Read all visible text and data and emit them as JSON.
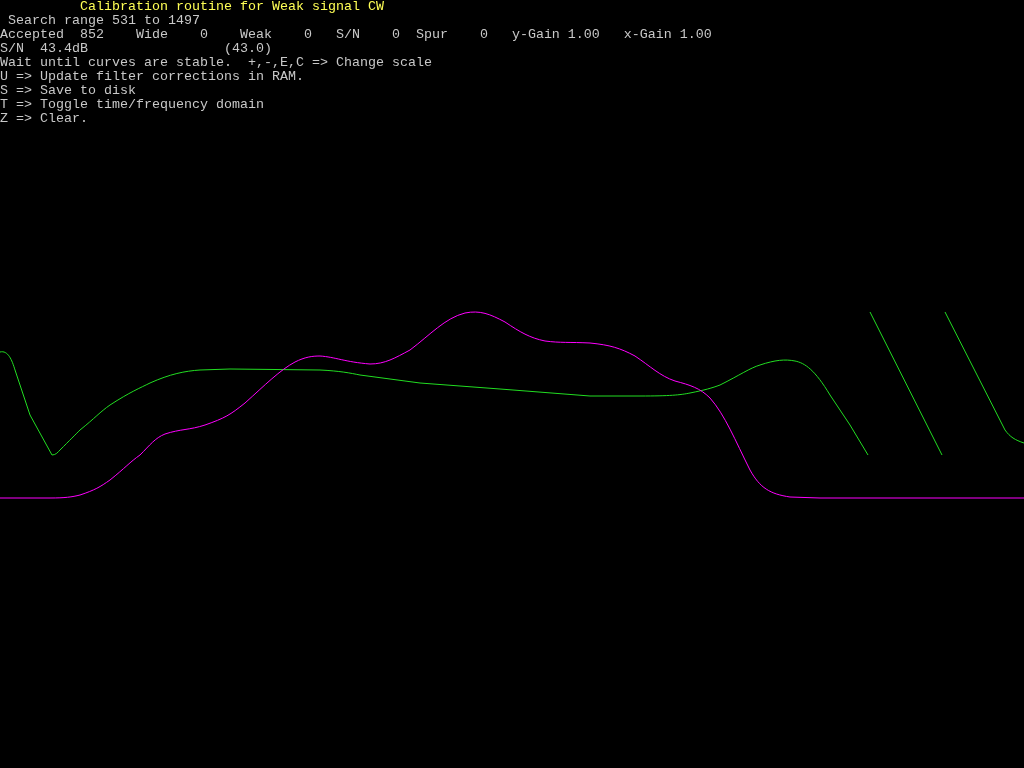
{
  "title": "Calibration routine for Weak signal CW",
  "lines": [
    " Search range 531 to 1497",
    "Accepted  852    Wide    0    Weak    0   S/N    0  Spur    0   y-Gain 1.00   x-Gain 1.00",
    "S/N  43.4dB                 (43.0)",
    "Wait until curves are stable.  +,-,E,C => Change scale",
    "U => Update filter corrections in RAM.",
    "S => Save to disk",
    "T => Toggle time/frequency domain",
    "Z => Clear."
  ]
}
